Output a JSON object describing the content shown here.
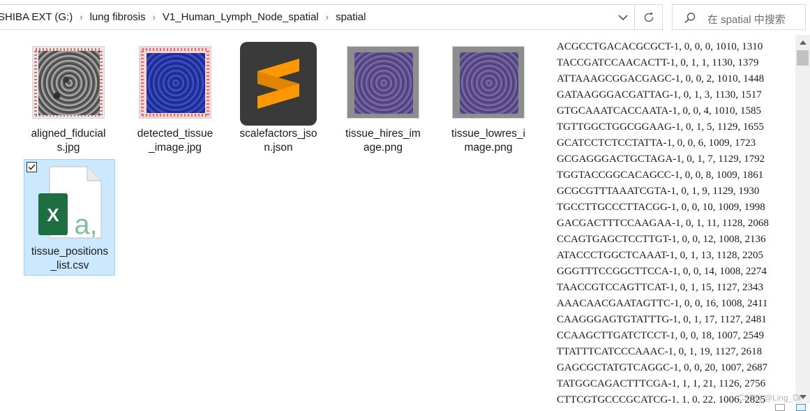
{
  "address": {
    "crumbs": [
      "SHIBA EXT (G:)",
      "lung fibrosis",
      "V1_Human_Lymph_Node_spatial",
      "spatial"
    ],
    "separator": "›"
  },
  "search": {
    "placeholder": "在 spatial 中搜索"
  },
  "icons": {
    "dropdown": "chevron-down-icon",
    "refresh": "refresh-icon",
    "search": "search-icon"
  },
  "files": [
    {
      "name": "aligned_fiducials.jpg",
      "label_lines": [
        "aligned_fiducial",
        "s.jpg"
      ],
      "thumb": "grayscale tissue image with red fiducial dots"
    },
    {
      "name": "detected_tissue_image.jpg",
      "label_lines": [
        "detected_tissue",
        "_image.jpg"
      ],
      "thumb": "blue detected tissue image"
    },
    {
      "name": "scalefactors_json.json",
      "label_lines": [
        "scalefactors_jso",
        "n.json"
      ],
      "thumb": "sublime-text-icon"
    },
    {
      "name": "tissue_hires_image.png",
      "label_lines": [
        "tissue_hires_im",
        "age.png"
      ],
      "thumb": "purple tissue image"
    },
    {
      "name": "tissue_lowres_image.png",
      "label_lines": [
        "tissue_lowres_i",
        "mage.png"
      ],
      "thumb": "purple tissue image"
    },
    {
      "name": "tissue_positions_list.csv",
      "label_lines": [
        "tissue_positions",
        "_list.csv"
      ],
      "thumb": "excel-csv-icon",
      "selected": true,
      "excel_letter": "X",
      "csv_letter": "a,"
    }
  ],
  "preview": {
    "lines": [
      "ACGCCTGACACGCGCT-1, 0, 0, 0, 1010, 1310",
      "TACCGATCCAACACTT-1, 0, 1, 1, 1130, 1379",
      "ATTAAAGCGGACGAGC-1, 0, 0, 2, 1010, 1448",
      "GATAAGGGACGATTAG-1, 0, 1, 3, 1130, 1517",
      "GTGCAAATCACCAATA-1, 0, 0, 4, 1010, 1585",
      "TGTTGGCTGGCGGAAG-1, 0, 1, 5, 1129, 1655",
      "GCATCCTCTCCTATTA-1, 0, 0, 6, 1009, 1723",
      "GCGAGGGACTGCTAGA-1, 0, 1, 7, 1129, 1792",
      "TGGTACCGGCACAGCC-1, 0, 0, 8, 1009, 1861",
      "GCGCGTTTAAATCGTA-1, 0, 1, 9, 1129, 1930",
      "TGCCTTGCCCTTACGG-1, 0, 0, 10, 1009, 1998",
      "GACGACTTTCCAAGAA-1, 0, 1, 11, 1128, 2068",
      "CCAGTGAGCTCCTTGT-1, 0, 0, 12, 1008, 2136",
      "ATACCCTGGCTCAAAT-1, 0, 1, 13, 1128, 2205",
      "GGGTTTCCGGCTTCCA-1, 0, 0, 14, 1008, 2274",
      "TAACCGTCCAGTTCAT-1, 0, 1, 15, 1127, 2343",
      "AAACAACGAATAGTTC-1, 0, 0, 16, 1008, 2411",
      "CAAGGGAGTGTATTTG-1, 0, 1, 17, 1127, 2481",
      "CCAAGCTTGATCTCCT-1, 0, 0, 18, 1007, 2549",
      "TTATTTCATCCCAAAC-1, 0, 1, 19, 1127, 2618",
      "GAGCGCTATGTCAGGC-1, 0, 0, 20, 1007, 2687",
      "TATGGCAGACTTTCGA-1, 1, 1, 21, 1126, 2756",
      "CTTCGTGCCCGCATCG-1, 1, 0, 22, 1006, 2825"
    ]
  },
  "watermark": "CSDN @Ling_Dr",
  "colors": {
    "selection_bg": "#cce8ff",
    "selection_border": "#99d1ff",
    "excel_green": "#1d6f42",
    "sublime_orange": "#ff9800",
    "sublime_bg": "#3a3a3a"
  }
}
